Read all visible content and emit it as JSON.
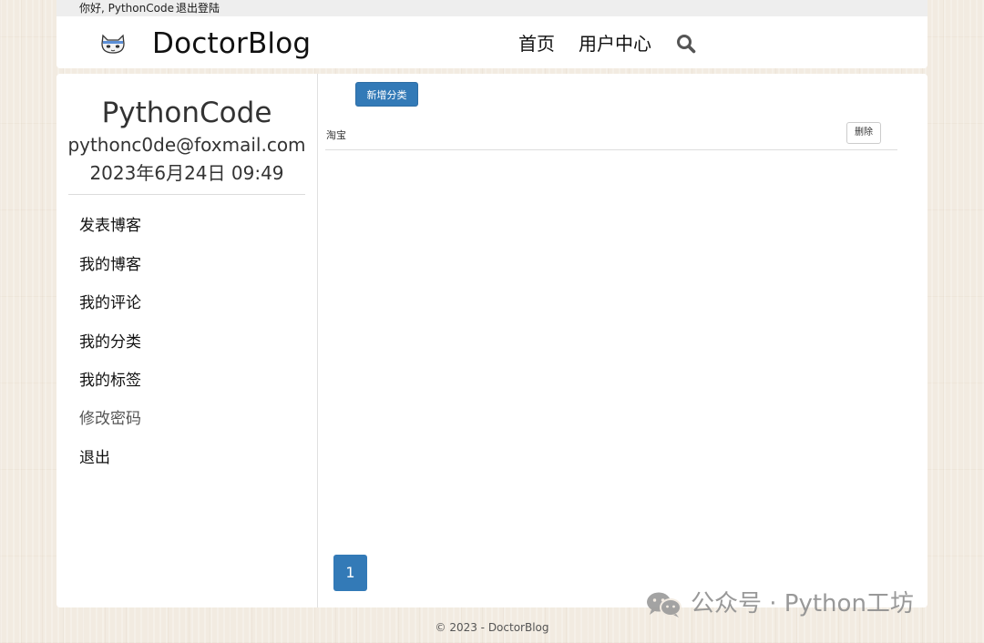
{
  "topbar": {
    "greeting": "你好, PythonCode",
    "logout": "退出登陆"
  },
  "navbar": {
    "brand": "DoctorBlog",
    "logo_icon": "cat-face-icon",
    "links": [
      "首页",
      "用户中心"
    ],
    "search_icon": "search-icon"
  },
  "profile": {
    "name": "PythonCode",
    "email": "pythonc0de@foxmail.com",
    "date": "2023年6月24日 09:49"
  },
  "menu": {
    "items": [
      "发表博客",
      "我的博客",
      "我的评论",
      "我的分类",
      "我的标签",
      "修改密码",
      "退出"
    ]
  },
  "content": {
    "add_button": "新增分类",
    "categories": [
      {
        "name": "淘宝",
        "delete_label": "删除"
      }
    ],
    "pagination": {
      "current": "1"
    }
  },
  "footer": {
    "text": "© 2023 - DoctorBlog"
  },
  "watermark": {
    "text": "公众号 · Python工坊",
    "icon": "wechat-icon"
  },
  "colors": {
    "primary": "#337ab7",
    "background": "#f2ebe1",
    "panel": "#ffffff"
  }
}
